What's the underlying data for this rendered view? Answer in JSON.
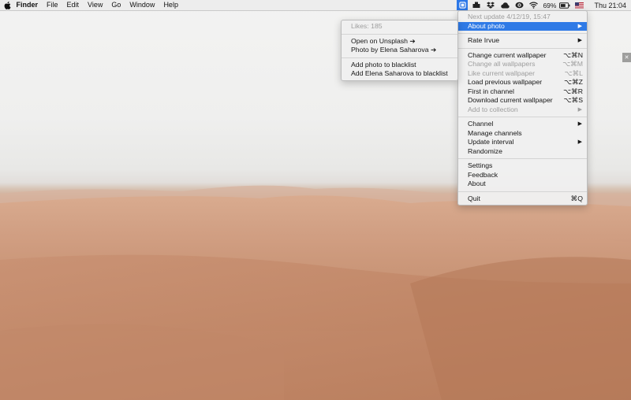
{
  "menubar": {
    "app_name": "Finder",
    "menus": [
      "File",
      "Edit",
      "View",
      "Go",
      "Window",
      "Help"
    ],
    "battery": "69%",
    "clock": "Thu 21:04"
  },
  "icons": {
    "apple": "apple-icon",
    "irvue": "irvue-icon",
    "status": [
      "printer-icon",
      "dropbox-icon",
      "creative-cloud-icon",
      "eye-icon",
      "wifi-icon",
      "battery-icon",
      "us-flag-icon"
    ]
  },
  "main_menu": {
    "next_update": "Next update 4/12/19, 15:47",
    "about_photo": "About photo",
    "rate": "Rate Irvue",
    "change_current": "Change current wallpaper",
    "change_current_sc": "⌥⌘N",
    "change_all": "Change all wallpapers",
    "change_all_sc": "⌥⌘M",
    "like": "Like current wallpaper",
    "like_sc": "⌥⌘L",
    "load_previous": "Load previous wallpaper",
    "load_previous_sc": "⌥⌘Z",
    "first_in_channel": "First in channel",
    "first_in_channel_sc": "⌥⌘R",
    "download": "Download current wallpaper",
    "download_sc": "⌥⌘S",
    "add_to_collection": "Add to collection",
    "channel": "Channel",
    "manage_channels": "Manage channels",
    "update_interval": "Update interval",
    "randomize": "Randomize",
    "settings": "Settings",
    "feedback": "Feedback",
    "about": "About",
    "quit": "Quit",
    "quit_sc": "⌘Q",
    "arrow": "▶"
  },
  "sub_menu": {
    "likes": "Likes: 185",
    "open_unsplash": "Open on Unsplash ➔",
    "photo_by": "Photo by Elena Saharova ➔",
    "add_photo_blacklist": "Add photo to blacklist",
    "add_author_blacklist": "Add Elena Saharova to blacklist"
  },
  "colors": {
    "highlight": "#2f7ae6",
    "sand": "#c9977a",
    "sky": "#efefee"
  },
  "corner": "✕"
}
